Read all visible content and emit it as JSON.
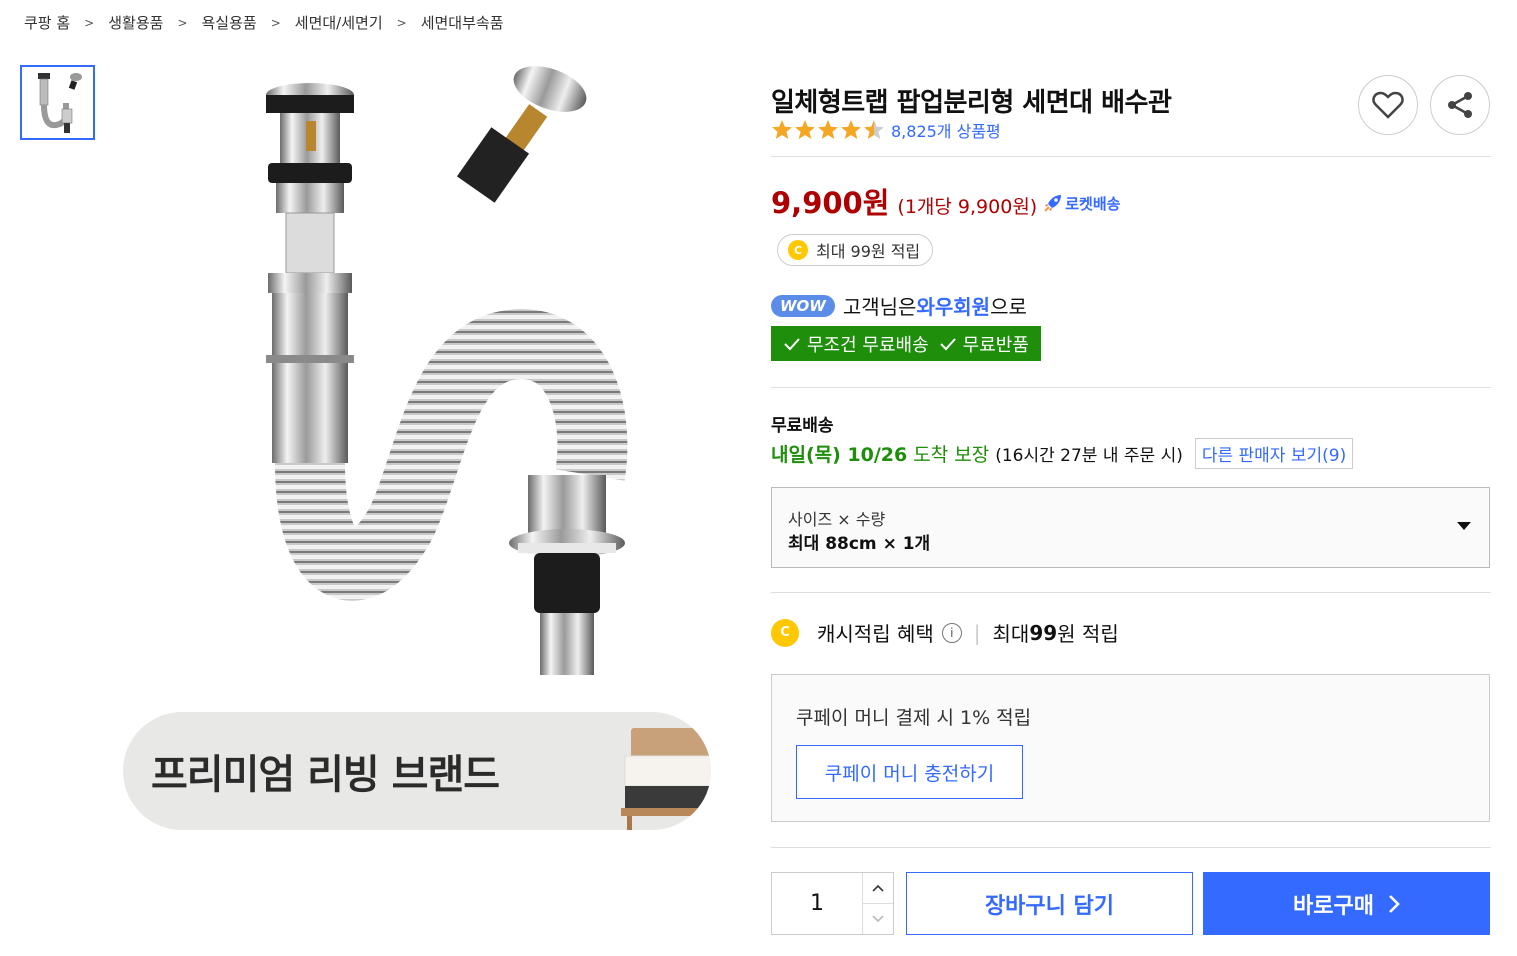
{
  "breadcrumb": {
    "items": [
      "쿠팡 홈",
      "생활용품",
      "욕실용품",
      "세면대/세면기",
      "세면대부속품"
    ],
    "separator": ">"
  },
  "product": {
    "title": "일체형트랩 팝업분리형 세면대 배수관",
    "rating_stars": 4.5,
    "review_count": "8,825개 상품평",
    "price": "9,900원",
    "unit_price": "(1개당 9,900원)",
    "rocket_label": "로켓배송"
  },
  "cash_pill": {
    "coin": "C",
    "text": "최대 99원 적립"
  },
  "wow": {
    "badge": "WOW",
    "prefix": "고객님은 ",
    "highlight": "와우회원",
    "suffix": "으로",
    "benefit_1": "무조건 무료배송",
    "benefit_2": "무료반품"
  },
  "shipping": {
    "label": "무료배송",
    "date": "내일(목) 10/26",
    "arrive": "도착 보장",
    "note": "(16시간 27분 내 주문 시)",
    "other_seller": "다른 판매자 보기(9)"
  },
  "option": {
    "label": "사이즈 × 수량",
    "value": "최대 88cm × 1개"
  },
  "cash_benefit": {
    "coin": "C",
    "title": "캐시적립 혜택",
    "info": "i",
    "prefix": "최대 ",
    "amount": "99",
    "suffix": "원 적립"
  },
  "coupay": {
    "desc": "쿠페이 머니 결제 시 1% 적립",
    "charge_button": "쿠페이 머니 충전하기"
  },
  "purchase": {
    "quantity": "1",
    "cart_button": "장바구니 담기",
    "buy_button": "바로구매"
  },
  "banner": {
    "text": "프리미엄 리빙 브랜드"
  },
  "colors": {
    "accent": "#346aff",
    "price_red": "#ae0000",
    "wow_green": "#1e8e0b",
    "star": "#f5a623"
  }
}
